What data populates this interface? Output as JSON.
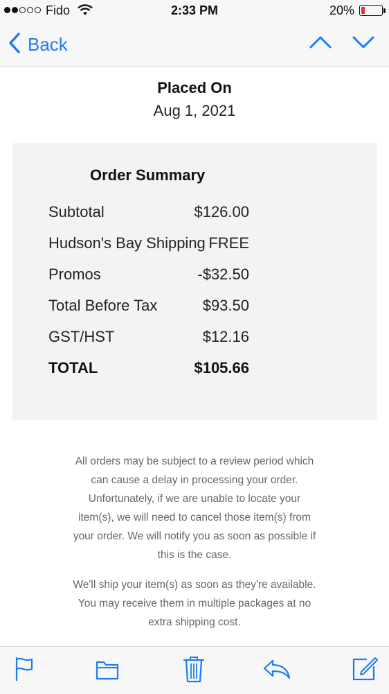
{
  "status_bar": {
    "carrier": "Fido",
    "time": "2:33 PM",
    "battery_percent": "20%",
    "battery_level": 0.2,
    "signal_bars_filled": 2,
    "signal_bars_total": 5,
    "icons": [
      "wifi-icon",
      "battery-icon"
    ]
  },
  "nav": {
    "back_label": "Back",
    "icons": [
      "chevron-left-icon",
      "chevron-up-icon",
      "chevron-down-icon"
    ]
  },
  "placed": {
    "title": "Placed On",
    "date": "Aug 1, 2021"
  },
  "summary": {
    "title": "Order Summary",
    "rows": [
      {
        "label": "Subtotal",
        "value": "$126.00"
      },
      {
        "label": "Hudson's Bay Shipping",
        "value": "FREE"
      },
      {
        "label": "Promos",
        "value": "-$32.50"
      },
      {
        "label": "Total Before Tax",
        "value": "$93.50"
      },
      {
        "label": "GST/HST",
        "value": "$12.16"
      },
      {
        "label": "TOTAL",
        "value": "$105.66"
      }
    ]
  },
  "notices": {
    "review_lines": [
      "All orders may be subject to a review period which",
      "can cause a delay in processing your order.",
      "Unfortunately, if we are unable to locate your",
      "item(s), we will need to cancel those item(s) from",
      "your order. We will notify you as soon as possible if",
      "this is the case."
    ],
    "shipping_lines": [
      "We'll ship your item(s) as soon as they're available.",
      "You may receive them in multiple packages at no",
      "extra shipping cost."
    ]
  },
  "toolbar": {
    "icons": [
      "flag-icon",
      "folder-icon",
      "trash-icon",
      "reply-icon",
      "compose-icon"
    ]
  },
  "colors": {
    "accent": "#1a7cf5",
    "battery_low": "#e0342f",
    "summary_bg": "#f3f3f3",
    "notice_text": "#666666"
  }
}
